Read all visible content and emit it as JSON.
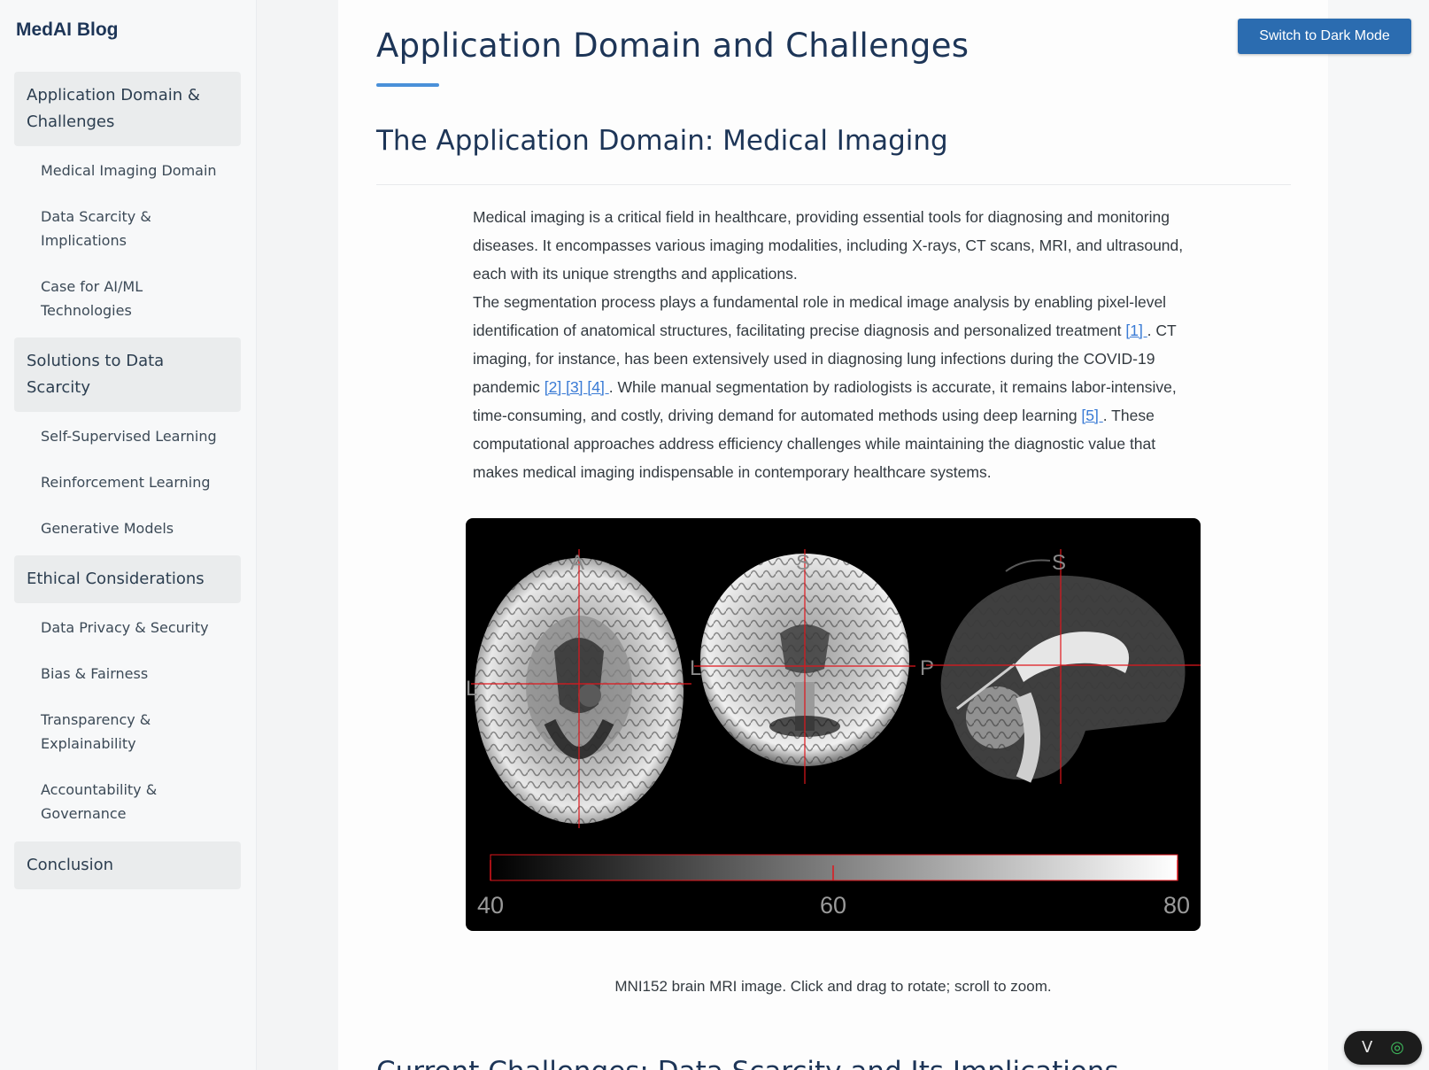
{
  "brand": "MedAI Blog",
  "sidebar": {
    "sections": [
      {
        "label": "Application Domain & Challenges",
        "items": [
          "Medical Imaging Domain",
          "Data Scarcity & Implications",
          "Case for AI/ML Technologies"
        ]
      },
      {
        "label": "Solutions to Data Scarcity",
        "items": [
          "Self-Supervised Learning",
          "Reinforcement Learning",
          "Generative Models"
        ]
      },
      {
        "label": "Ethical Considerations",
        "items": [
          "Data Privacy & Security",
          "Bias & Fairness",
          "Transparency & Explainability",
          "Accountability & Governance"
        ]
      },
      {
        "label": "Conclusion",
        "items": []
      }
    ]
  },
  "header": {
    "dark_mode_button": "Switch to Dark Mode"
  },
  "page_title": "Application Domain and Challenges",
  "section_title": "The Application Domain: Medical Imaging",
  "paragraph1": "Medical imaging is a critical field in healthcare, providing essential tools for diagnosing and monitoring diseases. It encompasses various imaging modalities, including X-rays, CT scans, MRI, and ultrasound, each with its unique strengths and applications.",
  "paragraph2": {
    "p1": "The segmentation process plays a fundamental role in medical image analysis by enabling pixel-level identification of anatomical structures, facilitating precise diagnosis and personalized treatment ",
    "c1": "[1] ",
    "p2": ". CT imaging, for instance, has been extensively used in diagnosing lung infections during the COVID-19 pandemic ",
    "c2": "[2] ",
    "c3": "[3] ",
    "c4": "[4] ",
    "p3": ". While manual segmentation by radiologists is accurate, it remains labor-intensive, time-consuming, and costly, driving demand for automated methods using deep learning ",
    "c5": "[5] ",
    "p4": ". These computational approaches address efficiency challenges while maintaining the diagnostic value that makes medical imaging indispensable in contemporary healthcare systems."
  },
  "figure": {
    "axial_labels": {
      "top": "A",
      "left": "L"
    },
    "coronal_labels": {
      "top": "S",
      "left": "L",
      "right": "P"
    },
    "sagittal_labels": {
      "top": "S"
    },
    "colorbar": {
      "min": "40",
      "mid": "60",
      "max": "80"
    },
    "crosshair_color": "#e0161c"
  },
  "caption": "MNI152 brain MRI image. Click and drag to rotate; scroll to zoom.",
  "next_heading": "Current Challenges: Data Scarcity and Its Implications",
  "widget": {
    "left_icon": "V",
    "right_icon": "◎"
  }
}
